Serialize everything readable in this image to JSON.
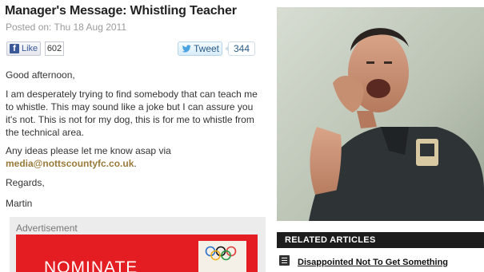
{
  "article": {
    "title": "Manager's Message: Whistling Teacher",
    "posted": "Posted on: Thu 18 Aug 2011"
  },
  "social": {
    "like_label": "Like",
    "like_count": "602",
    "tweet_label": "Tweet",
    "tweet_count": "344"
  },
  "body": {
    "greeting": "Good afternoon,",
    "paragraph": "I am desperately trying to find somebody that can teach me to whistle. This may sound like a joke but I can assure you it's not. This is not for my dog, this is for me to whistle from the technical area.",
    "request_prefix": "Any ideas please let me know asap via",
    "email": "media@nottscountyfc.co.uk",
    "request_suffix": ".",
    "signoff": "Regards,",
    "signature": "Martin"
  },
  "advert": {
    "label": "Advertisement",
    "banner_text": "NOMINATE"
  },
  "sidebar": {
    "related_heading": "RELATED ARTICLES",
    "related_items": [
      {
        "label": "Disappointed Not To Get Something"
      }
    ]
  },
  "colors": {
    "heading_bar": "#1d1d1d",
    "email_link": "#9a7a3a",
    "ad_red": "#e41d22",
    "facebook_blue": "#3b5998"
  }
}
